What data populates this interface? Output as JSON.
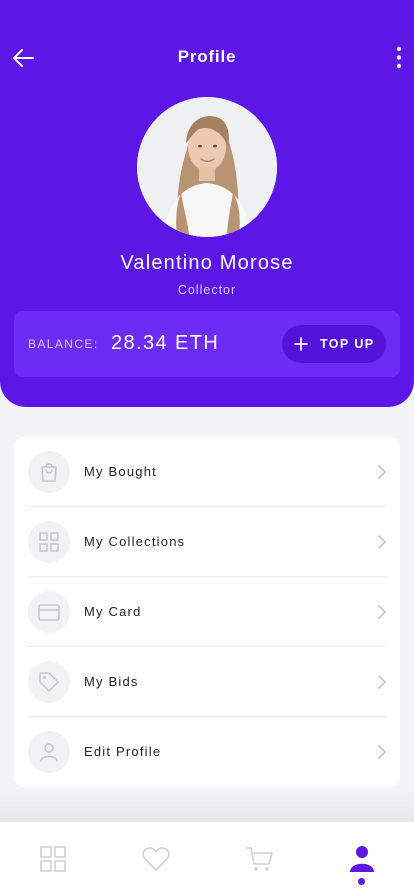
{
  "colors": {
    "accent": "#5c16e5",
    "balance_card": "#6c2cf6",
    "topup_button": "#5412d9",
    "icon_inactive": "#c9c9cf"
  },
  "header": {
    "title": "Profile",
    "back_icon": "arrow-left-icon",
    "more_icon": "more-vertical-icon"
  },
  "profile": {
    "name": "Valentino Morose",
    "role": "Collector",
    "avatar": "avatar-photo"
  },
  "balance": {
    "label": "BALANCE:",
    "value": "28.34 ETH",
    "topup_label": "TOP UP",
    "topup_icon": "plus-icon"
  },
  "menu": {
    "items": [
      {
        "label": "My Bought",
        "icon": "shopping-bag-icon"
      },
      {
        "label": "My Collections",
        "icon": "grid-icon"
      },
      {
        "label": "My Card",
        "icon": "credit-card-icon"
      },
      {
        "label": "My Bids",
        "icon": "tag-icon"
      },
      {
        "label": "Edit Profile",
        "icon": "user-icon"
      }
    ]
  },
  "tabbar": {
    "tabs": [
      {
        "icon": "grid-icon",
        "active": false
      },
      {
        "icon": "heart-icon",
        "active": false
      },
      {
        "icon": "cart-icon",
        "active": false
      },
      {
        "icon": "user-icon",
        "active": true
      }
    ]
  }
}
